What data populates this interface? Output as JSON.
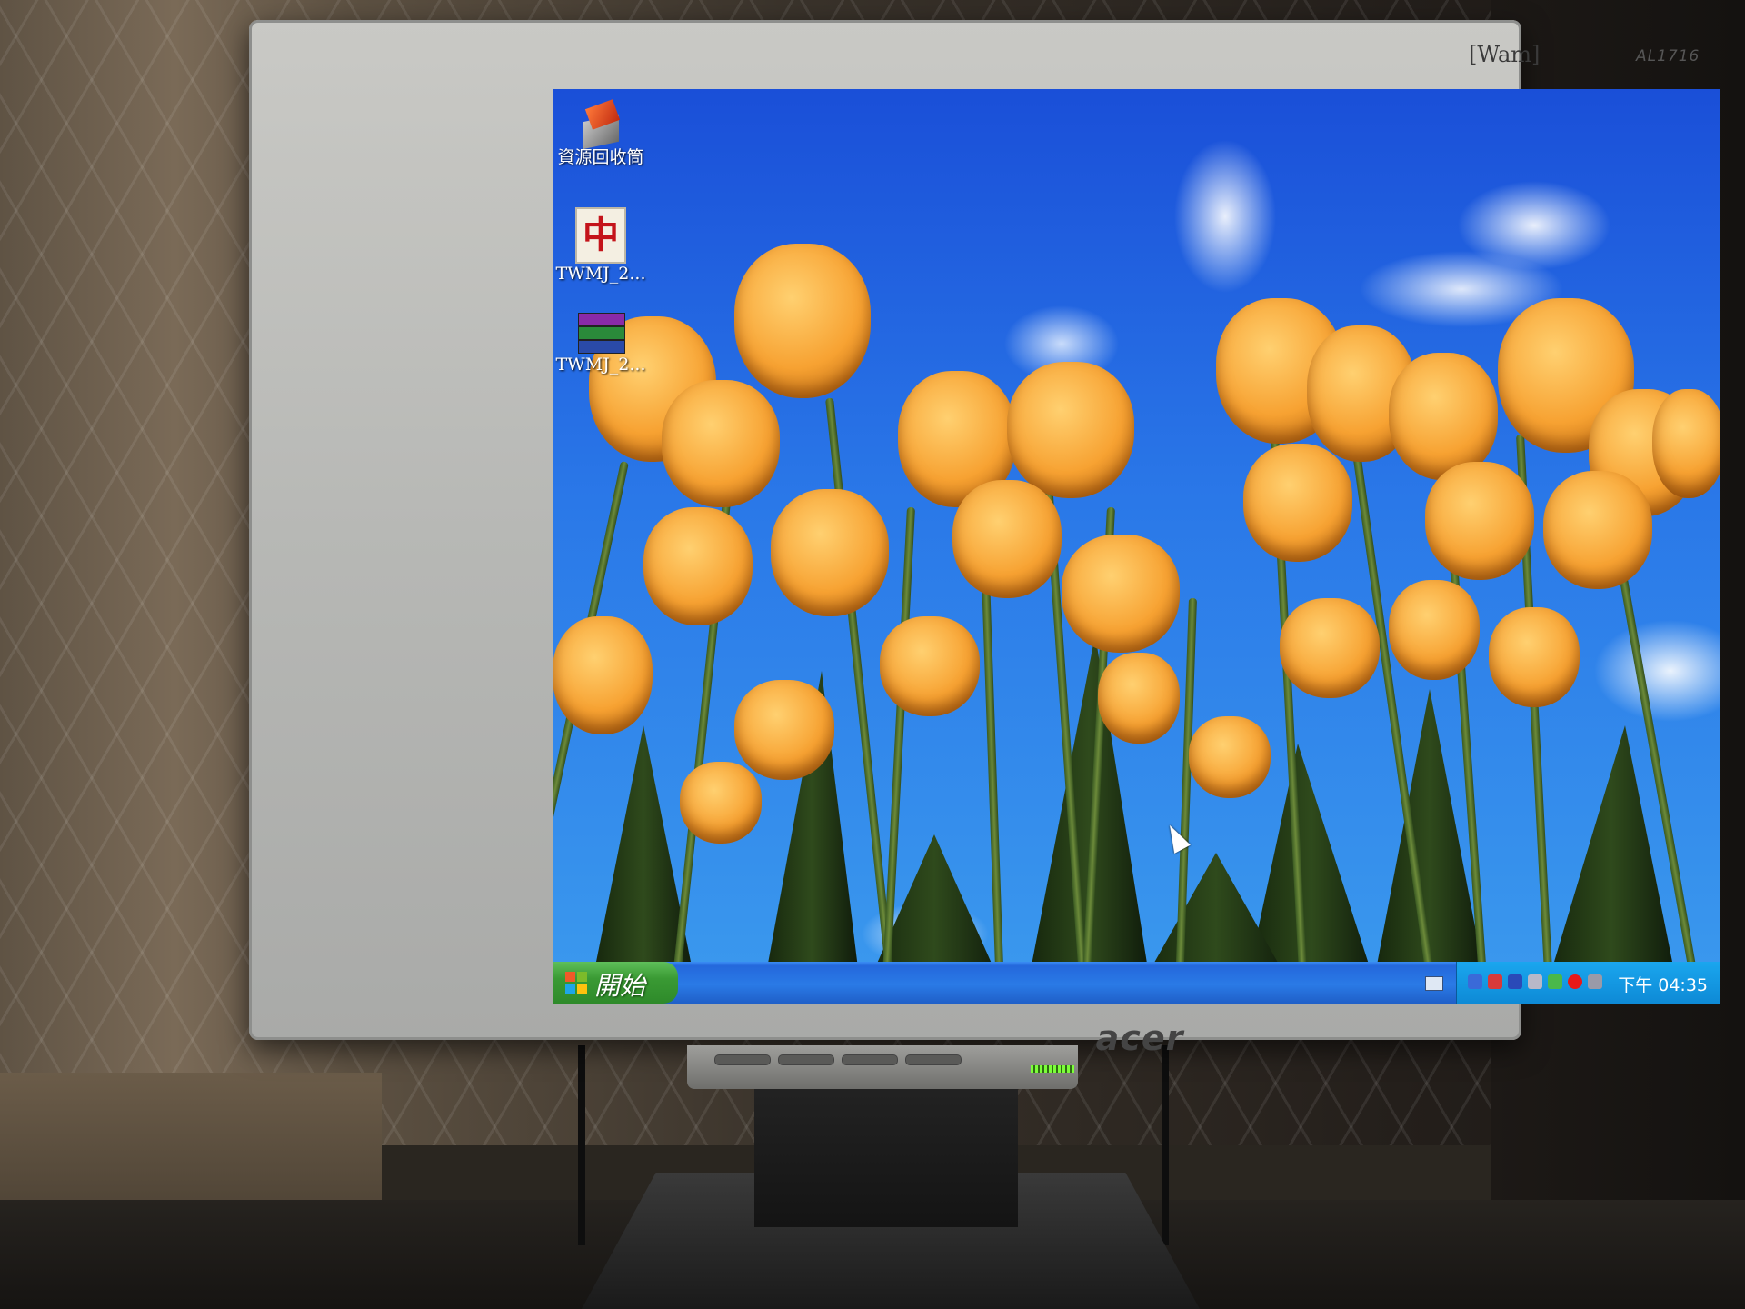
{
  "monitor": {
    "brand_top": "[Wam]",
    "model": "AL1716",
    "logo": "acer"
  },
  "desktop": {
    "icons": [
      {
        "label": "資源回收筒",
        "icon": "recycle-bin-icon"
      },
      {
        "label": "TWMJ_2...",
        "icon": "mahjong-tile-icon"
      },
      {
        "label": "TWMJ_2...",
        "icon": "winrar-archive-icon"
      }
    ],
    "wallpaper": "tulips"
  },
  "taskbar": {
    "start_label": "開始",
    "clock": "下午 04:35"
  },
  "colors": {
    "taskbar_blue": "#2468dc",
    "start_green": "#3a9a34",
    "tray_blue": "#0e8ad6",
    "bezel_silver": "#b7b8b5"
  }
}
